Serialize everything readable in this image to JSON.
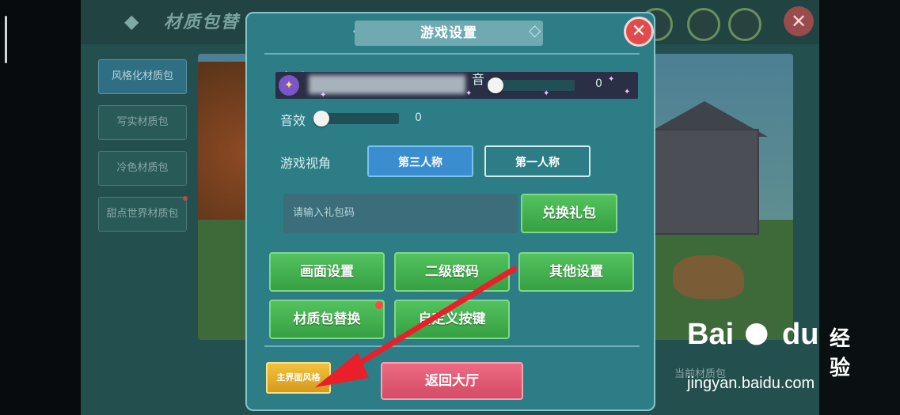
{
  "background": {
    "title": "材质包替",
    "side_buttons": [
      {
        "label": "风格化材质包"
      },
      {
        "label": "写实材质包"
      },
      {
        "label": "冷色材质包"
      },
      {
        "label": "甜点世界材质包"
      }
    ],
    "current_pack_label": "当前材质包"
  },
  "dialog": {
    "title": "游戏设置",
    "close_label": "✕",
    "music": {
      "label_left": "音乐",
      "label_right": "音",
      "value": "0"
    },
    "sfx": {
      "label": "音效",
      "value": "0"
    },
    "view": {
      "label": "游戏视角",
      "options": [
        "第三人称",
        "第一人称"
      ],
      "selected": "第三人称"
    },
    "gift": {
      "placeholder": "请输入礼包码",
      "redeem_label": "兑换礼包"
    },
    "buttons": {
      "graphics": "画面设置",
      "password": "二级密码",
      "other": "其他设置",
      "texture": "材质包替换",
      "keys": "自定义按键"
    },
    "main_style_label": "主界面风格",
    "back_label": "返回大厅"
  },
  "watermark": {
    "brand_left": "Bai",
    "brand_right": "du",
    "product": "经验",
    "url": "jingyan.baidu.com"
  },
  "colors": {
    "accent_green": "#36a042",
    "accent_red": "#d34b66",
    "accent_gold": "#d79a1c",
    "annotation_arrow": "#ea1f2a"
  }
}
